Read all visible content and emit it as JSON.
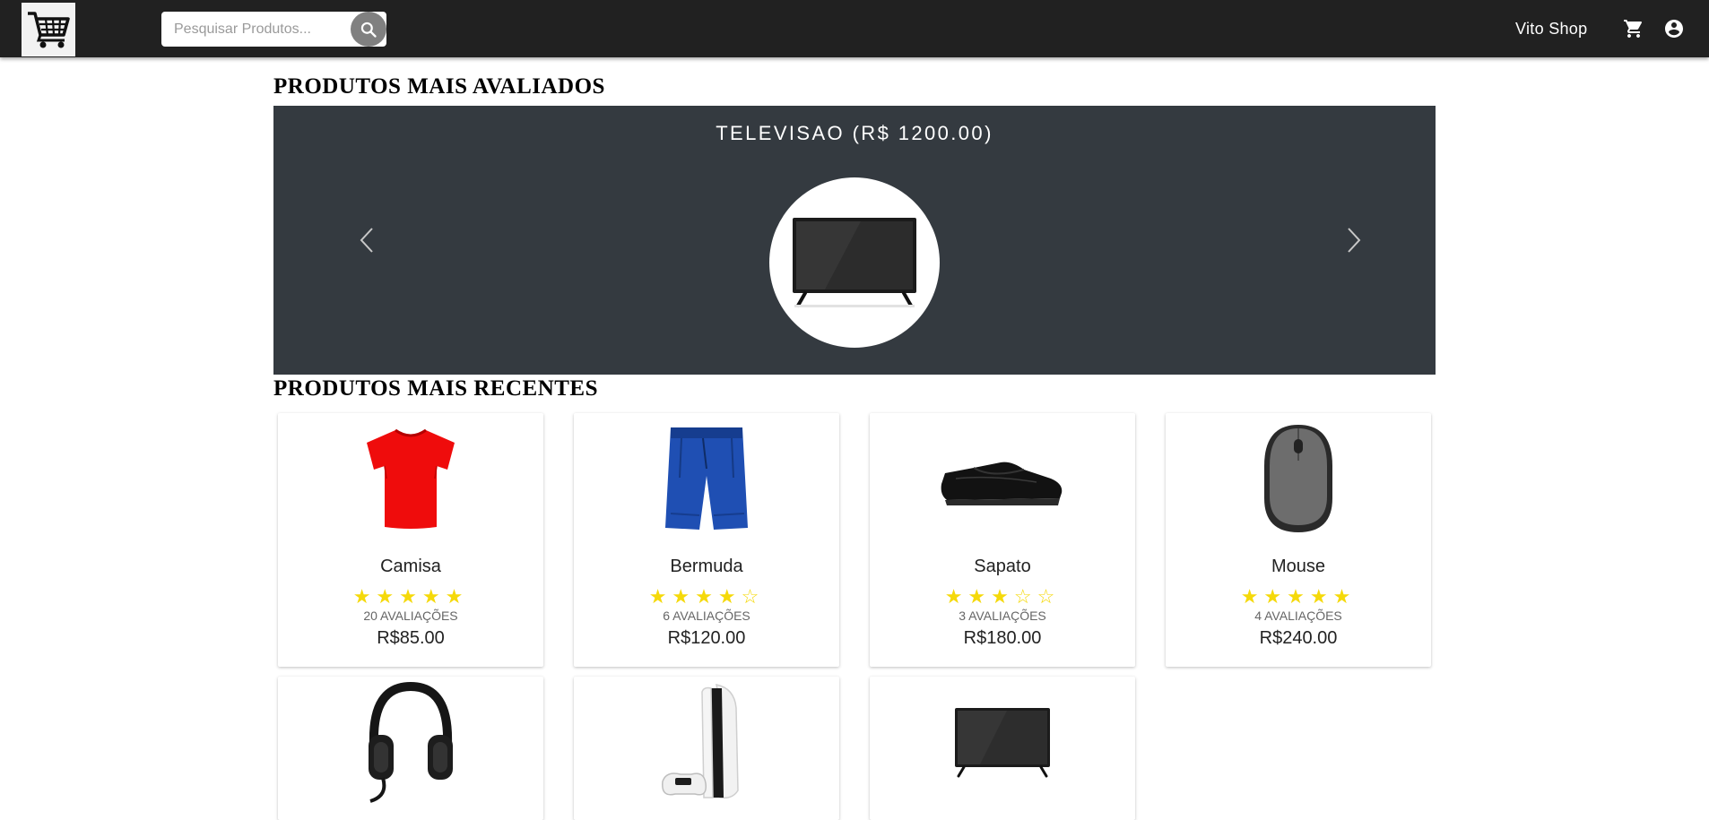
{
  "header": {
    "brand": "Vito Shop",
    "search_placeholder": "Pesquisar Produtos...",
    "logo_icon": "shopping-cart-logo",
    "search_icon": "search-icon",
    "cart_icon": "cart-icon",
    "account_icon": "account-circle-icon",
    "background": "#212121"
  },
  "top_rated": {
    "title": "PRODUTOS MAIS AVALIADOS",
    "caption": "TELEVISAO (R$ 1200.00)",
    "background": "#343a40"
  },
  "recent": {
    "title": "PRODUTOS MAIS RECENTES",
    "products": [
      {
        "name": "Camisa",
        "rating": 5,
        "stars": "★★★★★",
        "reviews": "20 AVALIAÇÕES",
        "price": "R$85.00",
        "image": "red-tshirt"
      },
      {
        "name": "Bermuda",
        "rating": 4,
        "stars": "★★★★☆",
        "reviews": "6 AVALIAÇÕES",
        "price": "R$120.00",
        "image": "blue-shorts"
      },
      {
        "name": "Sapato",
        "rating": 3,
        "stars": "★★★☆☆",
        "reviews": "3 AVALIAÇÕES",
        "price": "R$180.00",
        "image": "black-shoe"
      },
      {
        "name": "Mouse",
        "rating": 5,
        "stars": "★★★★★",
        "reviews": "4 AVALIAÇÕES",
        "price": "R$240.00",
        "image": "gray-mouse"
      },
      {
        "image": "headset"
      },
      {
        "image": "game-console"
      },
      {
        "image": "television"
      }
    ]
  },
  "colors": {
    "star": "#f5d90a",
    "accent": "#808080"
  }
}
